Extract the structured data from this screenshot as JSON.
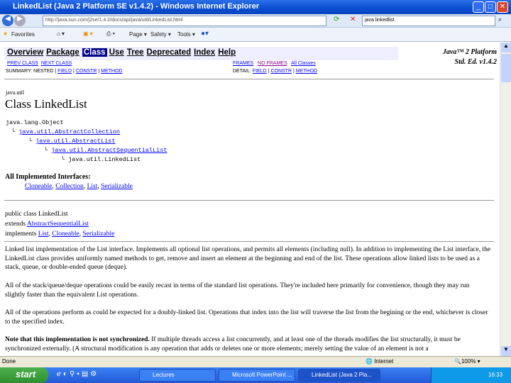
{
  "window": {
    "title": "LinkedList (Java 2 Platform SE v1.4.2) - Windows Internet Explorer"
  },
  "address": {
    "url": "http://java.sun.com/j2se/1.4.2/docs/api/java/util/LinkedList.html",
    "search": "java linkedlist"
  },
  "toolbar": {
    "favorites": "Favorites",
    "page": "Page",
    "safety": "Safety",
    "tools": "Tools"
  },
  "nav": {
    "items": [
      "Overview",
      "Package",
      "Class",
      "Use",
      "Tree",
      "Deprecated",
      "Index",
      "Help"
    ],
    "selected": "Class",
    "prev": "PREV CLASS",
    "next": "NEXT CLASS",
    "frames": "FRAMES",
    "noframes": "NO FRAMES",
    "allclasses": "All Classes",
    "summary": "SUMMARY: NESTED |",
    "field": "FIELD",
    "constr": "CONSTR",
    "method": "METHOD",
    "detail": "DETAIL:",
    "platform1": "Java™ 2 Platform",
    "platform2": "Std. Ed. v1.4.2"
  },
  "doc": {
    "package": "java.util",
    "title": "Class LinkedList",
    "tree": [
      "java.lang.Object",
      "java.util.AbstractCollection",
      "java.util.AbstractList",
      "java.util.AbstractSequentialList",
      "java.util.LinkedList"
    ],
    "interfaces_label": "All Implemented Interfaces:",
    "interfaces": [
      "Cloneable",
      "Collection",
      "List",
      "Serializable"
    ],
    "decl1": "public class LinkedList",
    "extends_kw": "extends ",
    "extends": "AbstractSequentialList",
    "implements_kw": "implements ",
    "p1": "Linked list implementation of the List interface. Implements all optional list operations, and permits all elements (including null). In addition to implementing the List interface, the LinkedList class provides uniformly named methods to get, remove and insert an element at the beginning and end of the list. These operations allow linked lists to be used as a stack, queue, or double-ended queue (deque).",
    "p2": "All of the stack/queue/deque operations could be easily recast in terms of the standard list operations. They're included here primarily for convenience, though they may run slightly faster than the equivalent List operations.",
    "p3": "All of the operations perform as could be expected for a doubly-linked list. Operations that index into the list will traverse the list from the begining or the end, whichever is closer to the specified index.",
    "p4_bold": "Note that this implementation is not synchronized.",
    "p4": " If multiple threads access a list concurrently, and at least one of the threads modifies the list structurally, it must be synchronized externally. (A structural modification is any operation that adds or deletes one or more elements; merely setting the value of an element is not a"
  },
  "status": {
    "text": "Done",
    "zone": "Internet",
    "zoom": "100%"
  },
  "taskbar": {
    "start": "start",
    "tasks": [
      "Lectures",
      "Microsoft PowerPoint ...",
      "LinkedList (Java 2 Pla..."
    ],
    "clock": "16:33"
  }
}
